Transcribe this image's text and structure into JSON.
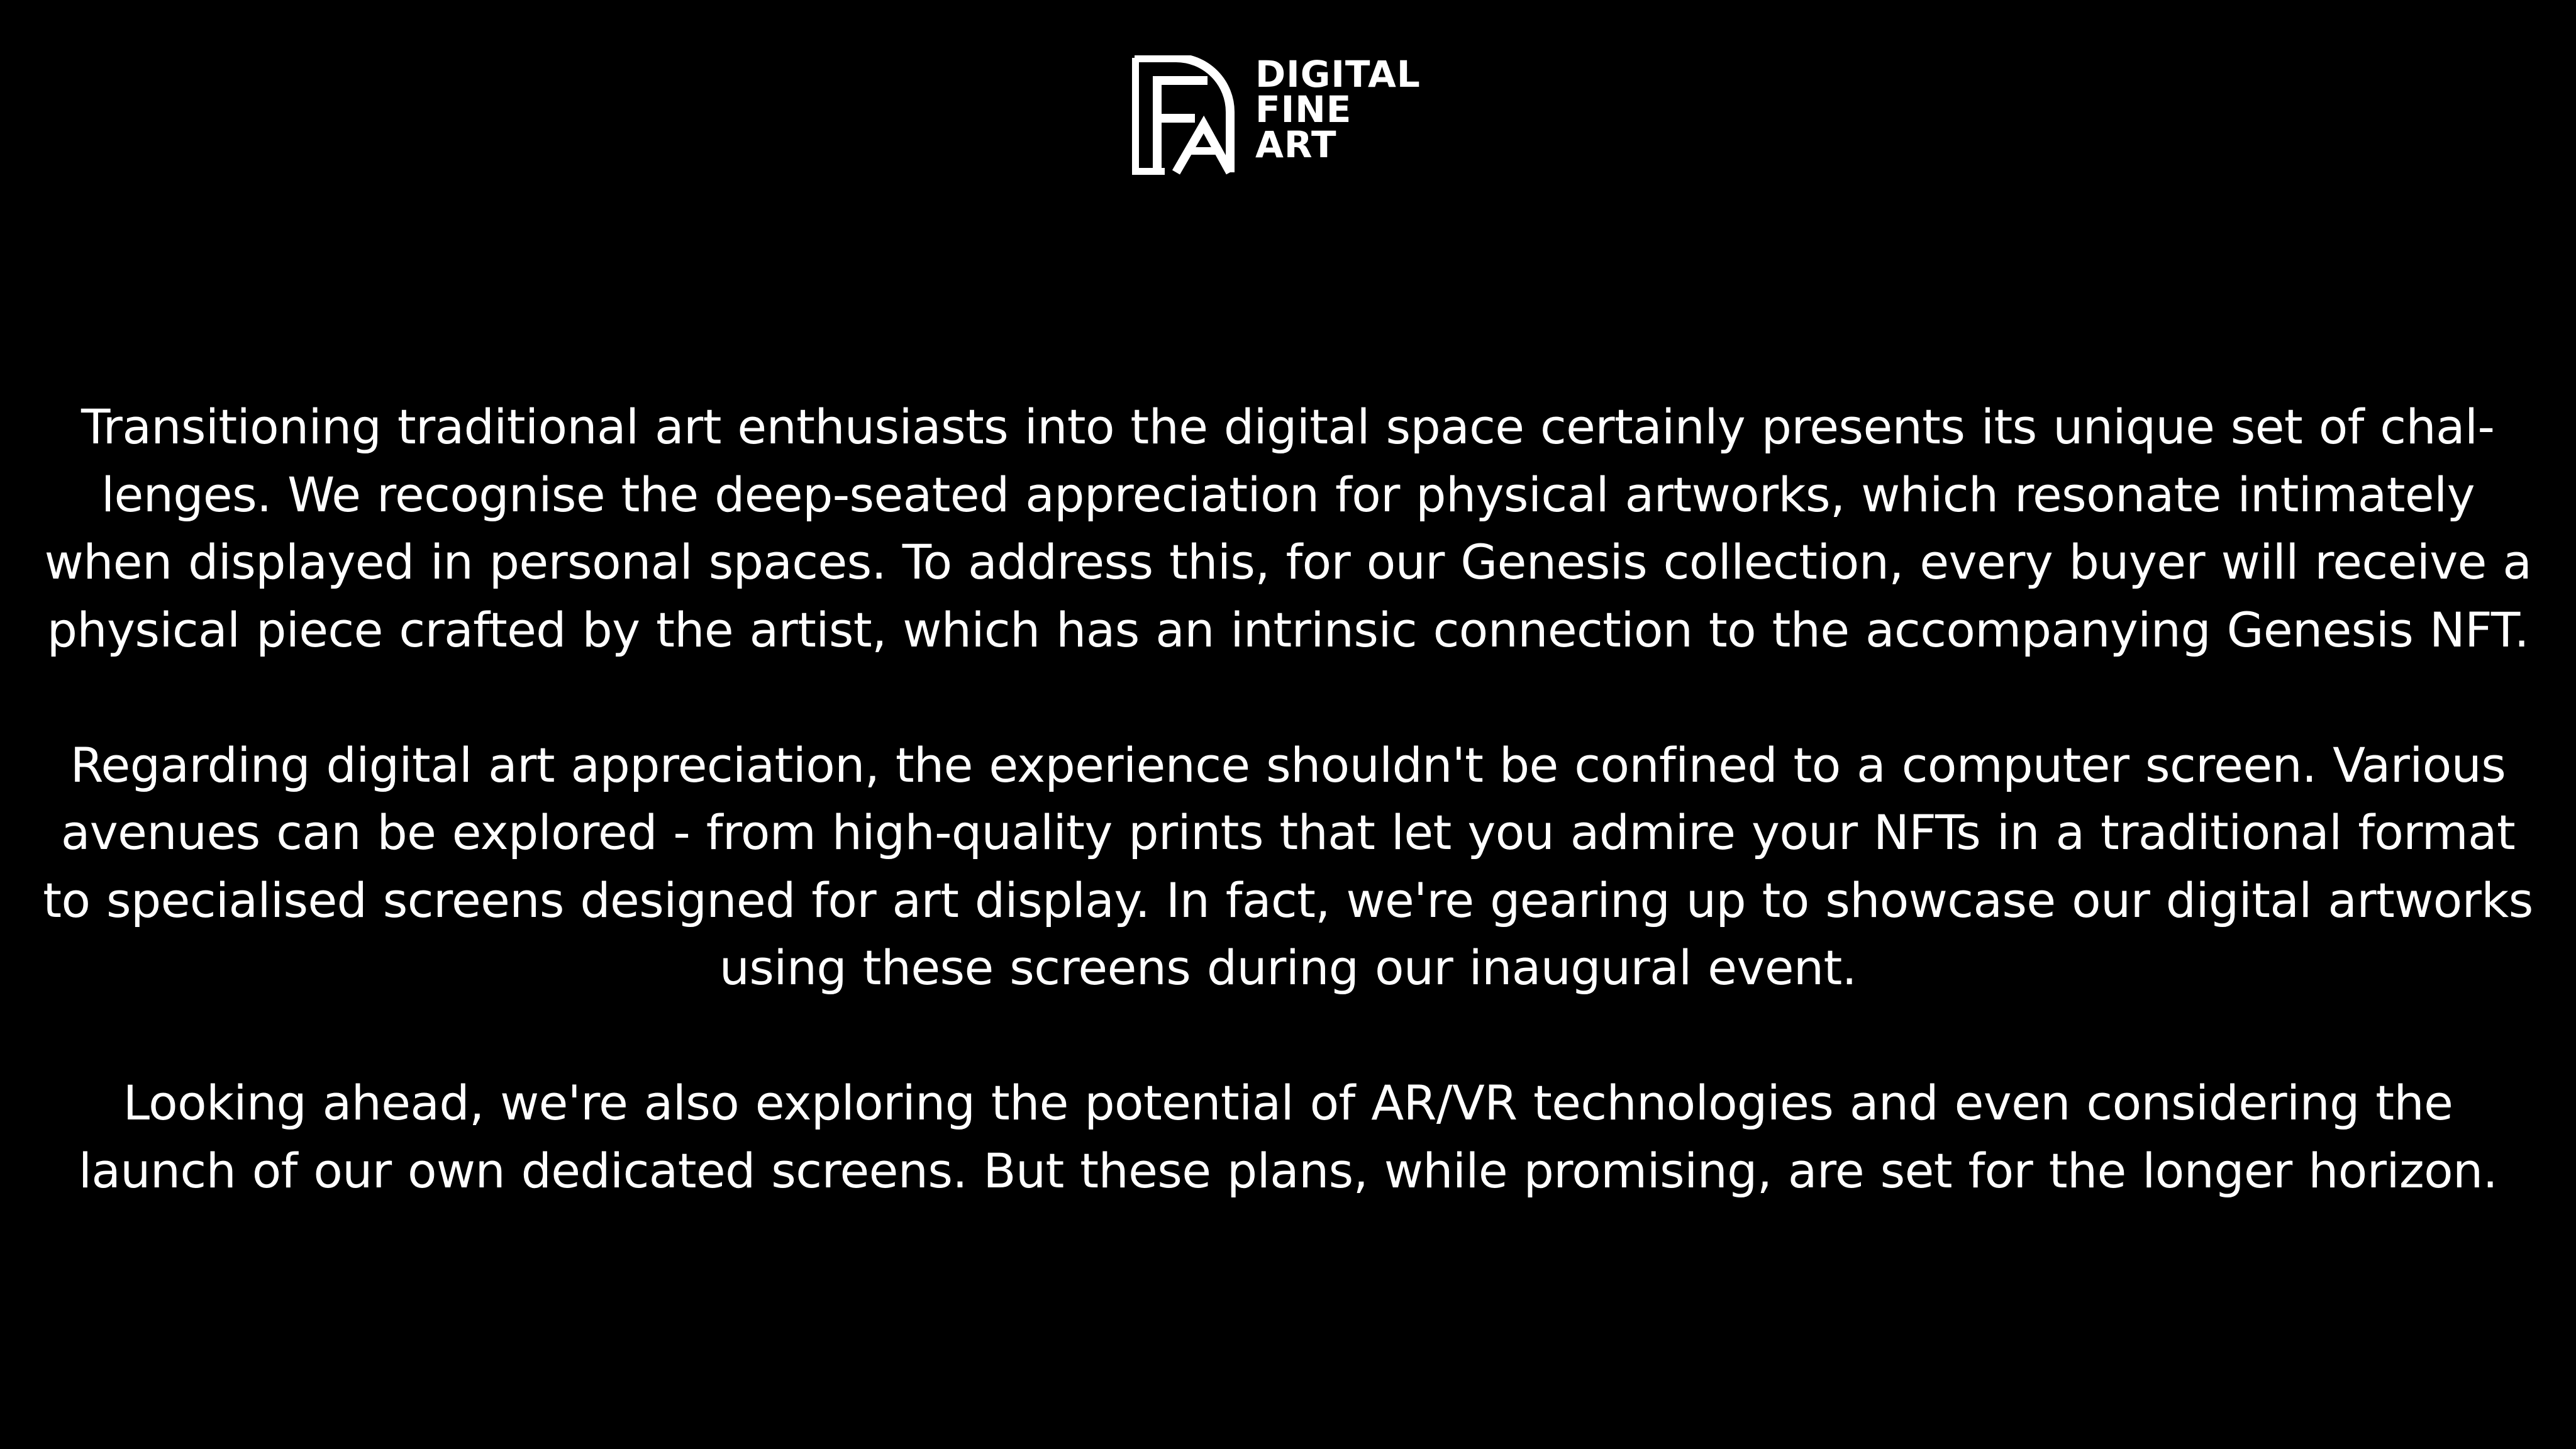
{
  "logo": {
    "word1": "DIGITAL",
    "word2": "FINE",
    "word3": "ART"
  },
  "paragraphs": [
    "Transitioning traditional art enthusiasts into the digital space certainly presents its unique set of chal­lenges. We recognise the deep-seated appreciation for physical artworks, which resonate intimately when displayed in personal spaces. To address this, for our Genesis collection, every buyer will receive a physical piece crafted by the artist, which has an intrinsic connection to the accompanying Genesis NFT.",
    "Regarding digital art appreciation, the experience shouldn't be confined to a computer screen. Various avenues can be explored - from high-quality prints that let you admire your NFTs in a traditional format to specialised screens designed for art display. In fact, we're gearing up to showcase our digital artworks using these screens during our inaugural event.",
    "Looking ahead, we're also exploring the potential of AR/VR technologies and even considering the launch of our own dedicated screens. But these plans, while promising, are set for the longer horizon."
  ],
  "colors": {
    "background": "#000000",
    "text": "#ffffff"
  }
}
